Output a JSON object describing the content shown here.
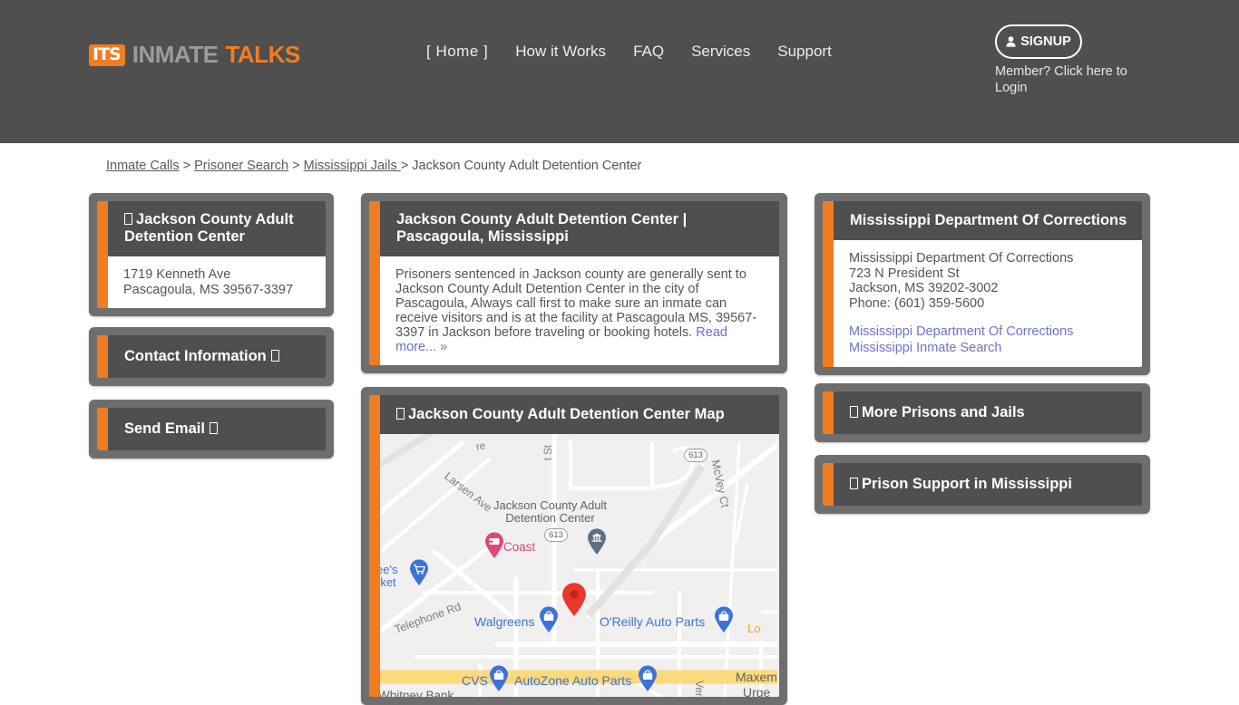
{
  "header": {
    "logo": {
      "badge": "ITS",
      "word1": "INMATE",
      "word2": "TALKS"
    },
    "nav": [
      {
        "label": "[  Home  ]",
        "name": "nav-home"
      },
      {
        "label": "How it Works",
        "name": "nav-how-it-works"
      },
      {
        "label": "FAQ",
        "name": "nav-faq"
      },
      {
        "label": "Services",
        "name": "nav-services"
      },
      {
        "label": "Support",
        "name": "nav-support"
      }
    ],
    "signup_label": "SIGNUP",
    "login_text": "Member? Click here to Login",
    "bg_color": "#4f4f4f"
  },
  "breadcrumb": {
    "items": [
      {
        "label": "Inmate Calls",
        "link": true
      },
      {
        "label": "Prisoner Search",
        "link": true
      },
      {
        "label": "Mississippi Jails ",
        "link": true
      },
      {
        "label": "Jackson County Adult Detention Center",
        "link": false
      }
    ],
    "separator": ">"
  },
  "facility_panel": {
    "title": "Jackson County Adult Detention Center",
    "address_line1": "1719 Kenneth Ave",
    "address_line2": "Pascagoula, MS 39567-3397"
  },
  "contact_panel": {
    "title": "Contact Information"
  },
  "email_panel": {
    "title": "Send Email"
  },
  "overview_panel": {
    "title": "Jackson County Adult Detention Center | Pascagoula, Mississippi",
    "body": "Prisoners sentenced in Jackson county are generally sent to Jackson County Adult Detention Center in the city of Pascagoula, Always call first to make sure an inmate can receive visitors and is at the facility at Pascagoula MS, 39567-3397 in Jackson before traveling or booking hotels. ",
    "read_more": "Read more...",
    "read_more_chevron": "»"
  },
  "map_panel": {
    "title": "Jackson County Adult Detention Center Map",
    "labels": {
      "place": "Jackson County Adult Detention Center",
      "place_line1": "Jackson County Adult",
      "place_line2": "Detention Center",
      "road_larsen": "Larsen Ave",
      "road_telephone": "Telephone Rd",
      "road_mcvey": "McVey Ct",
      "road_st_top": "t St",
      "road_ave_top": "re",
      "shield_613_top": "613",
      "shield_613_mid": "613",
      "poi_coast": "Coast",
      "poi_rouses_line1": "ee's",
      "poi_rouses_line2": "rket",
      "poi_walgreens": "Walgreens",
      "poi_oreilly": "O'Reilly Auto Parts",
      "poi_cvs": "CVS",
      "poi_autozone": "AutoZone Auto Parts",
      "poi_whitney": "Whitney Bank",
      "poi_lo": "Lo",
      "poi_maxem1": "Maxem",
      "poi_maxem2": "Urge",
      "poi_verd": "Verd"
    },
    "marker_colors": {
      "main": "#e8382b",
      "lodging": "#e0457b",
      "civic": "#5b7083",
      "shopping": "#3c73d9"
    }
  },
  "doc_panel": {
    "title": "Mississippi Department Of Corrections",
    "name": "Mississippi Department Of Corrections",
    "street": "723 N President St",
    "city": "Jackson, MS 39202-3002",
    "phone": "Phone: (601) 359-5600",
    "link1": "Mississippi Department Of Corrections",
    "link2": "Mississippi Inmate Search"
  },
  "more_panel": {
    "title": "More Prisons and Jails"
  },
  "support_panel": {
    "title": "Prison Support in Mississippi"
  },
  "theme": {
    "accent": "#f07d21",
    "panel_frame": "#6e6e6e",
    "panel_head": "#4f4f4f",
    "link": "#6b6fd0"
  }
}
